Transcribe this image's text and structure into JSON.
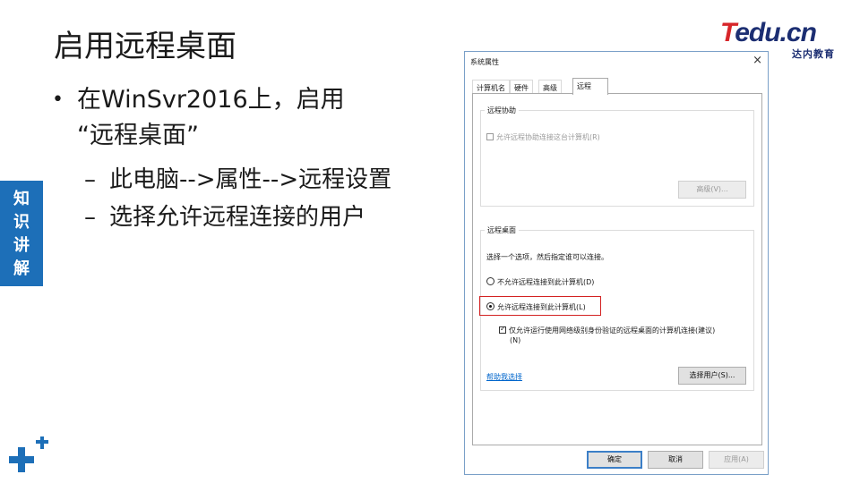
{
  "slide": {
    "title": "启用远程桌面",
    "bullet1": "在WinSvr2016上，启用",
    "bullet1b": "“远程桌面”",
    "sub1": "此电脑-->属性-->远程设置",
    "sub2": "选择允许远程连接的用户",
    "bullet_glyph": "•",
    "dash_glyph": "–"
  },
  "side_tab": {
    "chars": [
      "知",
      "识",
      "讲",
      "解"
    ]
  },
  "logo": {
    "main_t": "T",
    "main_rest": "edu.cn",
    "sub": "达内教育"
  },
  "dialog": {
    "title": "系统属性",
    "close_glyph": "×",
    "tabs": [
      "计算机名",
      "硬件",
      "高级",
      "远程"
    ],
    "remote_assist": {
      "legend": "远程协助",
      "allow_label": "允许远程协助连接这台计算机(R)",
      "advanced_button": "高级(V)..."
    },
    "remote_desktop": {
      "legend": "远程桌面",
      "prompt": "选择一个选项，然后指定谁可以连接。",
      "option_disallow": "不允许远程连接到此计算机(D)",
      "option_allow": "允许远程连接到此计算机(L)",
      "nla_label_1": "仅允许运行使用网络级别身份验证的远程桌面的计算机连接(建议)",
      "nla_label_2": "(N)",
      "help_link": "帮助我选择",
      "select_users_button": "选择用户(S)..."
    },
    "buttons": {
      "ok": "确定",
      "cancel": "取消",
      "apply": "应用(A)"
    }
  },
  "colors": {
    "accent_blue": "#1d6fb8",
    "highlight_red": "#d32222",
    "logo_navy": "#1c2e72",
    "logo_red": "#d7262a"
  }
}
